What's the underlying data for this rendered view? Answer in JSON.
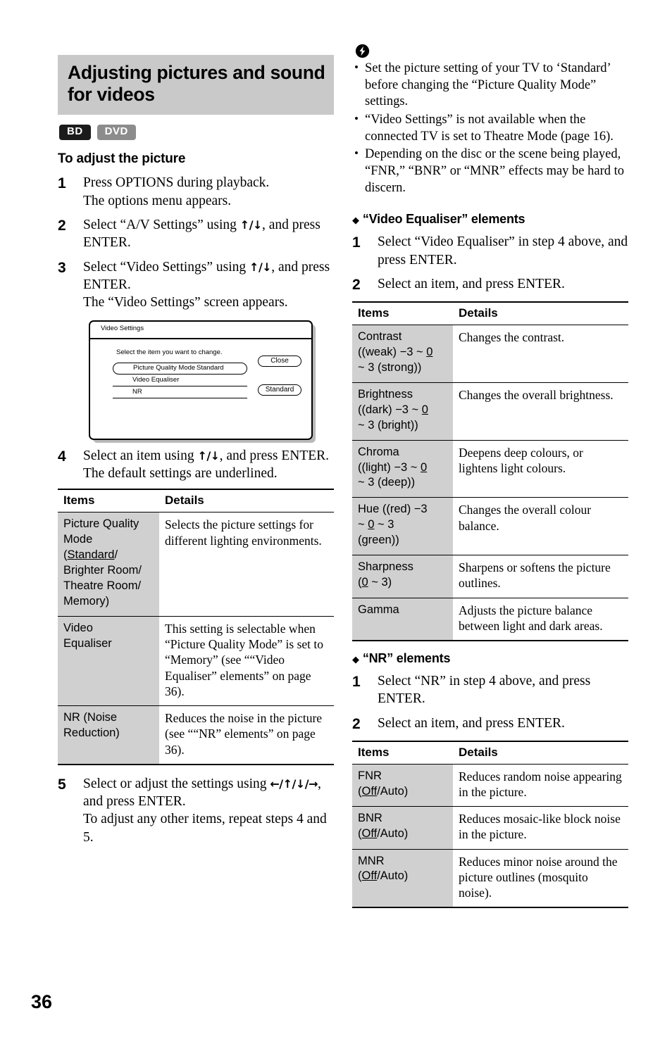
{
  "page": {
    "number": "36"
  },
  "header": {
    "title": "Adjusting pictures and sound for videos",
    "badges": [
      {
        "label": "BD",
        "color": "#1b1b1b"
      },
      {
        "label": "DVD",
        "color": "#8c8c8c"
      }
    ]
  },
  "left": {
    "subheading": "To adjust the picture",
    "steps": [
      {
        "num": "1",
        "line1": "Press OPTIONS during playback.",
        "line2": "The options menu appears."
      },
      {
        "num": "2",
        "line1_a": "Select “A/V Settings” using ",
        "arrows": "↑/↓",
        "line1_b": ", and press ENTER.",
        "line2": ""
      },
      {
        "num": "3",
        "line1_a": "Select “Video Settings” using ",
        "arrows": "↑/↓",
        "line1_b": ", and press ENTER.",
        "line2": "The “Video Settings” screen appears."
      },
      {
        "num": "4",
        "line1_a": "Select an item using ",
        "arrows": "↑/↓",
        "line1_b": ", and press ENTER.",
        "line2": "The default settings are underlined."
      },
      {
        "num": "5",
        "line1_a": "Select or adjust the settings using ",
        "arrows": "←/↑/↓/→",
        "line1_b": ", and press ENTER.",
        "line2": "To adjust any other items, repeat steps 4 and 5."
      }
    ],
    "screenshot": {
      "title": "Video Settings",
      "instruction": "Select the item you want to change.",
      "rows": [
        {
          "label": "Picture Quality Mode",
          "value": "Standard",
          "selected": true
        },
        {
          "label": "Video Equaliser",
          "value": "",
          "selected": false
        },
        {
          "label": "NR",
          "value": "",
          "selected": false
        }
      ],
      "buttons": [
        {
          "label": "Close"
        },
        {
          "label": "Standard"
        }
      ]
    },
    "table": {
      "headers": [
        "Items",
        "Details"
      ],
      "rows": [
        {
          "item_lines": [
            "Picture Quality",
            "Mode",
            "(Standard/",
            "Brighter Room/",
            "Theatre Room/",
            "Memory)"
          ],
          "item_underline": "Standard",
          "detail": "Selects the picture settings for different lighting environments."
        },
        {
          "item_lines": [
            "Video",
            "Equaliser"
          ],
          "item_underline": "",
          "detail": "This setting is selectable when “Picture Quality Mode” is set to “Memory” (see ““Video Equaliser” elements” on page 36)."
        },
        {
          "item_lines": [
            "NR (Noise",
            "Reduction)"
          ],
          "item_underline": "",
          "detail": "Reduces the noise in the picture (see ““NR” elements” on page 36)."
        }
      ]
    }
  },
  "right": {
    "note_icon": "note-bolt-icon",
    "notes": [
      "Set the picture setting of your TV to ‘Standard’ before changing the “Picture Quality Mode” settings.",
      "“Video Settings” is not available when the connected TV is set to Theatre Mode (page 16).",
      "Depending on the disc or the scene being played, “FNR,” “BNR” or “MNR” effects may be hard to discern."
    ],
    "section_equaliser": {
      "heading": "“Video Equaliser” elements",
      "steps": [
        {
          "num": "1",
          "text": "Select “Video Equaliser” in step 4 above, and press ENTER."
        },
        {
          "num": "2",
          "text": "Select an item, and press ENTER."
        }
      ],
      "table": {
        "headers": [
          "Items",
          "Details"
        ],
        "rows": [
          {
            "item_lines": [
              "Contrast",
              "((weak) −3 ~ 0",
              "~ 3 (strong))"
            ],
            "item_underline": "0",
            "detail": "Changes the contrast."
          },
          {
            "item_lines": [
              "Brightness",
              "((dark) −3 ~ 0",
              "~ 3 (bright))"
            ],
            "item_underline": "0",
            "detail": "Changes the overall brightness."
          },
          {
            "item_lines": [
              "Chroma",
              "((light) −3 ~ 0",
              "~ 3 (deep))"
            ],
            "item_underline": "0",
            "detail": "Deepens deep colours, or lightens light colours."
          },
          {
            "item_lines": [
              "Hue ((red) −3",
              "~ 0 ~ 3",
              "(green))"
            ],
            "item_underline": "0",
            "detail": "Changes the overall colour balance."
          },
          {
            "item_lines": [
              "Sharpness",
              "(0 ~ 3)"
            ],
            "item_underline": "0",
            "detail": "Sharpens or softens the picture outlines."
          },
          {
            "item_lines": [
              "Gamma"
            ],
            "item_underline": "",
            "detail": "Adjusts the picture balance between light and dark areas."
          }
        ]
      }
    },
    "section_nr": {
      "heading": "“NR” elements",
      "steps": [
        {
          "num": "1",
          "text": "Select “NR” in step 4 above, and press ENTER."
        },
        {
          "num": "2",
          "text": "Select an item, and press ENTER."
        }
      ],
      "table": {
        "headers": [
          "Items",
          "Details"
        ],
        "rows": [
          {
            "item_lines": [
              "FNR",
              "(Off/Auto)"
            ],
            "item_underline": "Off",
            "detail": "Reduces random noise appearing in the picture."
          },
          {
            "item_lines": [
              "BNR",
              "(Off/Auto)"
            ],
            "item_underline": "Off",
            "detail": "Reduces mosaic-like block noise in the picture."
          },
          {
            "item_lines": [
              "MNR",
              "(Off/Auto)"
            ],
            "item_underline": "Off",
            "detail": "Reduces minor noise around the picture outlines (mosquito noise)."
          }
        ]
      }
    }
  }
}
